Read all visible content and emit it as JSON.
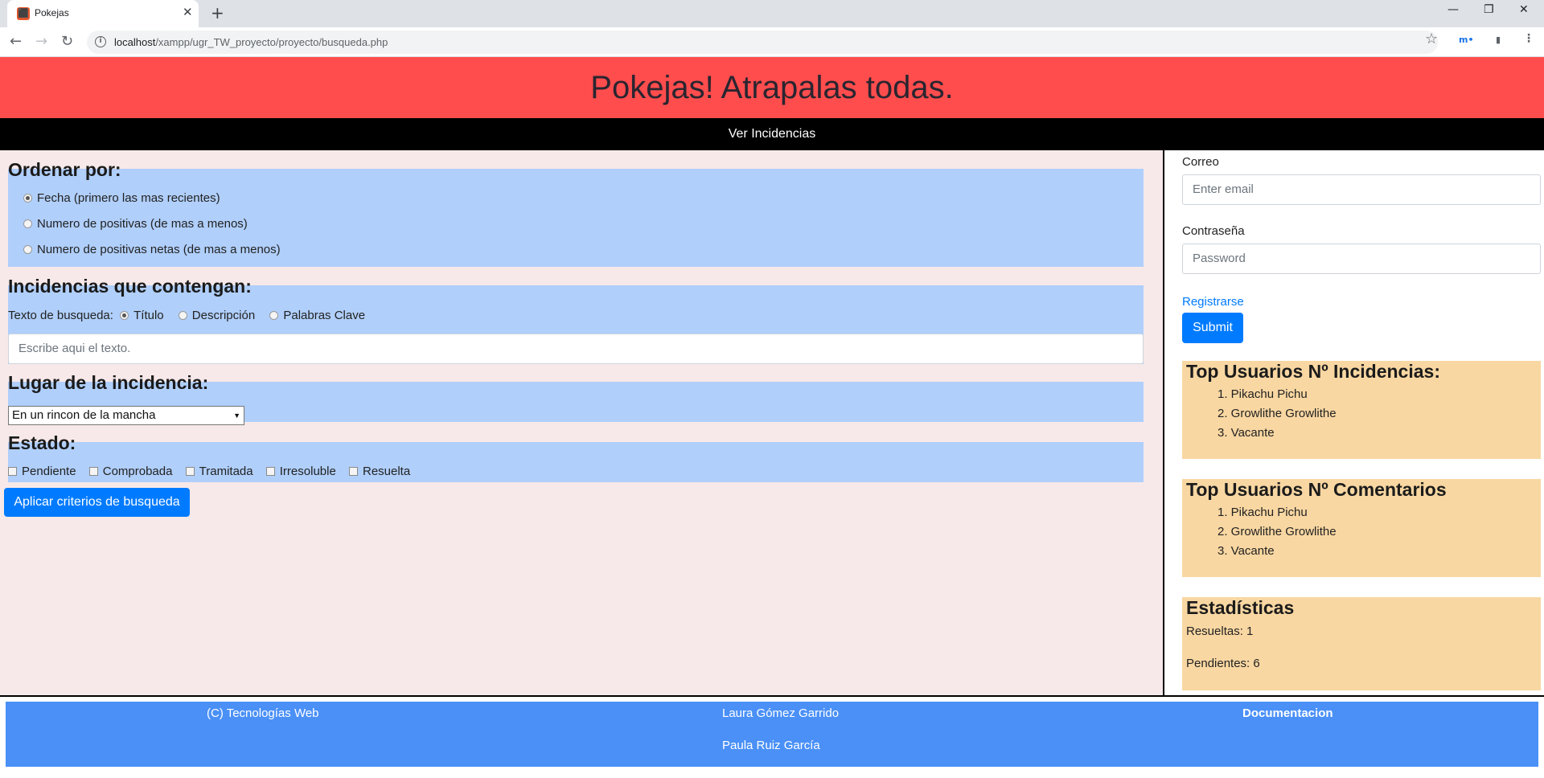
{
  "browser": {
    "tab_title": "Pokejas",
    "tab_favicon": "xampp-favicon",
    "url_host": "localhost",
    "url_path": "/xampp/ugr_TW_proyecto/proyecto/busqueda.php"
  },
  "header": {
    "title": "Pokejas! Atrapalas todas."
  },
  "nav": {
    "link": "Ver Incidencias"
  },
  "order": {
    "heading": "Ordenar por:",
    "options": [
      {
        "label": "Fecha (primero las mas recientes)",
        "checked": true
      },
      {
        "label": "Numero de positivas (de mas a menos)",
        "checked": false
      },
      {
        "label": "Numero de positivas netas (de mas a menos)",
        "checked": false
      }
    ]
  },
  "contain": {
    "heading": "Incidencias que contengan:",
    "search_label": "Texto de busqueda:",
    "options": [
      {
        "label": "Título",
        "checked": true
      },
      {
        "label": "Descripción",
        "checked": false
      },
      {
        "label": "Palabras Clave",
        "checked": false
      }
    ],
    "placeholder": "Escribe aqui el texto."
  },
  "place": {
    "heading": "Lugar de la incidencia:",
    "selected": "En un rincon de la mancha"
  },
  "state": {
    "heading": "Estado:",
    "options": [
      "Pendiente",
      "Comprobada",
      "Tramitada",
      "Irresoluble",
      "Resuelta"
    ]
  },
  "apply_button": "Aplicar criterios de busqueda",
  "login": {
    "email_label": "Correo",
    "email_placeholder": "Enter email",
    "password_label": "Contraseña",
    "password_placeholder": "Password",
    "register_link": "Registrarse",
    "submit": "Submit"
  },
  "top_incidencias": {
    "heading": "Top Usuarios Nº Incidencias:",
    "items": [
      "1. Pikachu Pichu",
      "2. Growlithe Growlithe",
      "3. Vacante"
    ]
  },
  "top_comentarios": {
    "heading": "Top Usuarios Nº Comentarios",
    "items": [
      "1. Pikachu Pichu",
      "2. Growlithe Growlithe",
      "3. Vacante"
    ]
  },
  "stats": {
    "heading": "Estadísticas",
    "resueltas": "Resueltas: 1",
    "pendientes": "Pendientes: 6"
  },
  "footer": {
    "copyright": "(C) Tecnologías Web",
    "author1": "Laura Gómez Garrido",
    "author2": "Paula Ruiz García",
    "doc_link": "Documentacion"
  }
}
